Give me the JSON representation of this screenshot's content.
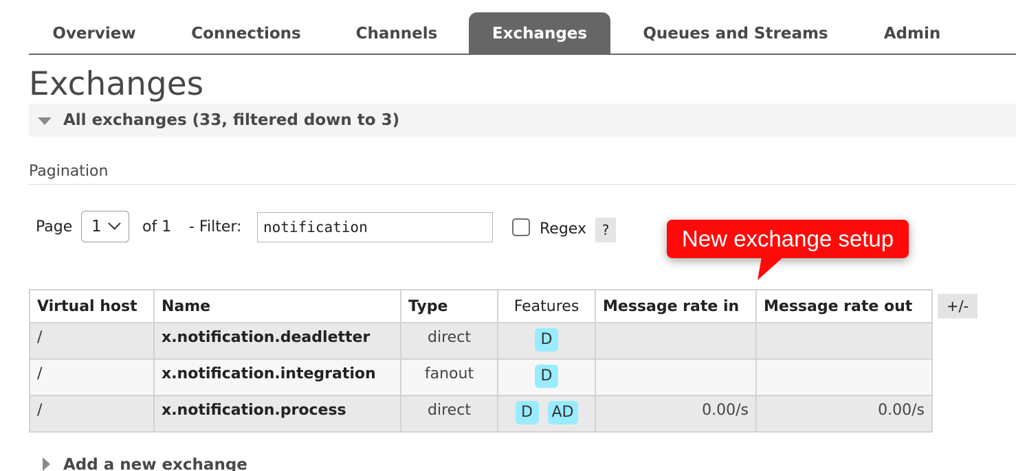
{
  "tabs": [
    {
      "label": "Overview",
      "active": false
    },
    {
      "label": "Connections",
      "active": false
    },
    {
      "label": "Channels",
      "active": false
    },
    {
      "label": "Exchanges",
      "active": true
    },
    {
      "label": "Queues and Streams",
      "active": false
    },
    {
      "label": "Admin",
      "active": false
    }
  ],
  "page_title": "Exchanges",
  "section_header": "All exchanges (33, filtered down to 3)",
  "pagination": {
    "label": "Pagination",
    "page_label": "Page",
    "page_value": "1",
    "of_label": "of 1",
    "filter_label": "- Filter:",
    "filter_value": "notification",
    "regex_label": "Regex",
    "help_label": "?"
  },
  "callout": {
    "text": "New exchange setup",
    "color": "#ff0a0a"
  },
  "table": {
    "headers": [
      "Virtual host",
      "Name",
      "Type",
      "Features",
      "Message rate in",
      "Message rate out"
    ],
    "rows": [
      {
        "vhost": "/",
        "name": "x.notification.deadletter",
        "type": "direct",
        "features": [
          "D"
        ],
        "rate_in": "",
        "rate_out": ""
      },
      {
        "vhost": "/",
        "name": "x.notification.integration",
        "type": "fanout",
        "features": [
          "D"
        ],
        "rate_in": "",
        "rate_out": ""
      },
      {
        "vhost": "/",
        "name": "x.notification.process",
        "type": "direct",
        "features": [
          "D",
          "AD"
        ],
        "rate_in": "0.00/s",
        "rate_out": "0.00/s"
      }
    ],
    "columns_toggle": "+/-",
    "badge_color": "#99ebff"
  },
  "add_section": "Add a new exchange"
}
